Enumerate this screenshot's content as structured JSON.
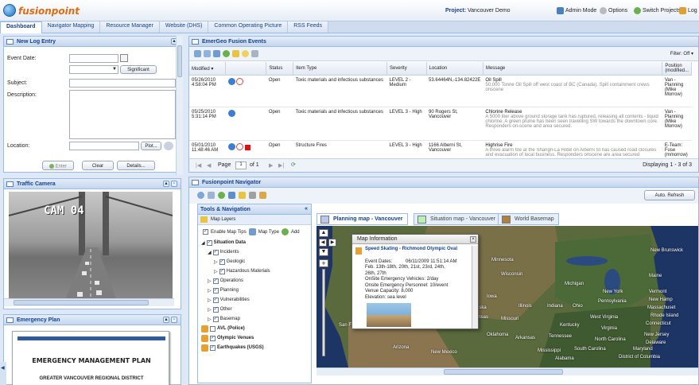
{
  "app": {
    "logo": "fusionpoint",
    "project_label": "Project:",
    "project": "Vancouver Demo",
    "admin_mode": "Admin Mode",
    "options": "Options",
    "switch_projects": "Switch Projects",
    "logout": "Log"
  },
  "tabs": [
    "Dashboard",
    "Navigator Mapping",
    "Resource Manager",
    "Website (DHS)",
    "Common Operating Picture",
    "RSS Feeds"
  ],
  "log_entry": {
    "title": "New Log Entry",
    "event_date_label": "Event Date:",
    "significant": "Significant",
    "subject_label": "Subject:",
    "description_label": "Description:",
    "location_label": "Location:",
    "plot_button": "Plot...",
    "enter_button": "Enter",
    "clear_button": "Clear",
    "details_button": "Details..."
  },
  "traffic_camera": {
    "title": "Traffic Camera",
    "cam_label": "CAM 04"
  },
  "emergency_plan": {
    "title": "Emergency Plan",
    "doc_title": "EMERGENCY MANAGEMENT PLAN",
    "doc_subtitle": "GREATER VANCOUVER REGIONAL DISTRICT"
  },
  "events": {
    "title": "EmerGeo Fusion Events",
    "filter": "Filter: Off",
    "columns": [
      "Modified",
      "Status",
      "Item Type",
      "Severity",
      "Location",
      "Message",
      "Position (modified..."
    ],
    "rows": [
      {
        "date": "05/26/2010",
        "time": "4:58:04 PM",
        "status": "Open",
        "item_type": "Toxic materials and infectious substances",
        "severity": "LEVEL 2 - Medium",
        "location": "53.64464N,-134.82422E",
        "msg_title": "Oil Spill",
        "msg_body": "50,000 Tonne Oil Spill off west coast of BC (Canada). Spill containment crews onscene",
        "position": "Van - Planning (Mike Morrow)"
      },
      {
        "date": "05/25/2010",
        "time": "5:31:14 PM",
        "status": "Open",
        "item_type": "Toxic materials and infectious substances",
        "severity": "LEVEL 3 - High",
        "location": "90 Rogers St, Vancouver",
        "msg_title": "Chlorine Release",
        "msg_body": "A 5000 liter above ground storage tank has ruptured, releasing all contents - liquid chlorine. A green plume has been seen travelling SW towards the downtown core. Responders on-scene and area secured.",
        "position": "Van - Planning (Mike Morrow)"
      },
      {
        "date": "05/01/2010",
        "time": "11:48:46 AM",
        "status": "Open",
        "item_type": "Structure Fires",
        "severity": "LEVEL 3 - High",
        "location": "1166 Alberni St, Vancouver",
        "msg_title": "Highrise Fire",
        "msg_body": "A three alarm fire at the Shangri-La Hotel on Alberni St has caused road closures and evacuation of local business. Responders onscene are area secured",
        "position": "E-Team: Fuse (mmorrow)"
      }
    ],
    "page_label": "Page",
    "page": "1",
    "of_pages": "of 1",
    "displaying": "Displaying 1 - 3 of 3"
  },
  "navigator": {
    "title": "Fusionpoint Navigator",
    "auto_refresh": "Auto. Refresh",
    "tools_title": "Tools & Navigation",
    "map_layers": "Map Layers",
    "enable_tips": "Enable Map Tips",
    "map_type": "Map Type",
    "add": "Add",
    "tree": [
      "Situation Data",
      "Incidents",
      "Geologic",
      "Hazardous Materials",
      "Operations",
      "Planning",
      "Vulnerabilities",
      "Other",
      "Basemap",
      "AVL (Police)",
      "Olympic Venues",
      "Earthquakes (USGS)"
    ],
    "map_tabs": [
      "Planning map - Vancouver",
      "Situation map - Vancouver",
      "World Basemap"
    ],
    "popup": {
      "title": "Map Information",
      "heading": "Speed Skating - Richmond Olympic Oval",
      "lines": [
        "Event Dates:          06/11/2009 11:51:14 AM",
        "Feb. 13th-18th, 20th, 21st, 23rd, 24th,",
        "26th, 27th",
        "OnSite Emergency Vehicles: 2/day",
        "Onsite Emergency Personnel: 10/event",
        "Venue Capacity: 8,000",
        "Elevation: sea level"
      ]
    },
    "states": [
      "Minnesota",
      "Wisconsin",
      "Michigan",
      "New York",
      "Iowa",
      "Illinois",
      "Indiana",
      "Ohio",
      "Pennsylvania",
      "Kansas",
      "Missouri",
      "Kentucky",
      "Virginia",
      "Oklahoma",
      "Arkansas",
      "Tennessee",
      "North Carolina",
      "South Carolina",
      "Mississippi",
      "Alabama",
      "Arizona",
      "New Mexico",
      "Maine",
      "Vermont",
      "New Brunswick",
      "New Hamp",
      "Massachuset",
      "Rhode Island",
      "Connecticut",
      "New Jersey",
      "Delaware",
      "Maryland",
      "District of Columbia",
      "West Virginia",
      "Nebraska",
      "San Francisco"
    ]
  },
  "colors": {
    "accent": "#15428b",
    "panel_border": "#99bbe8",
    "logo": "#e06b10"
  }
}
